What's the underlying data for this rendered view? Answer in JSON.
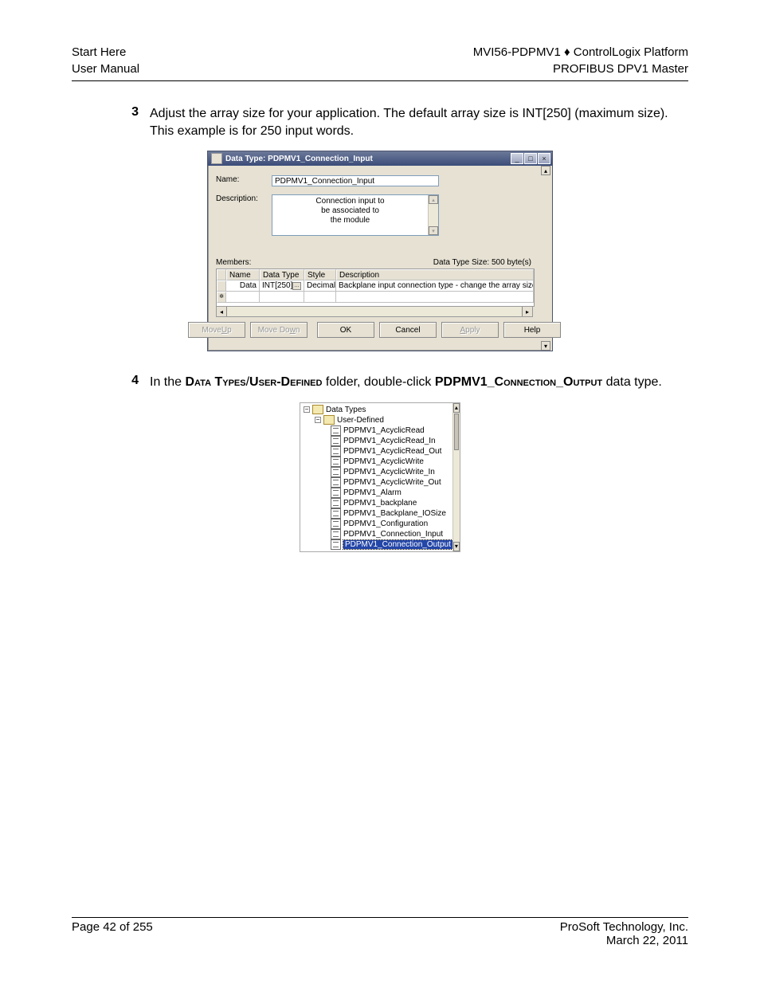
{
  "header": {
    "left1": "Start Here",
    "left2": "User Manual",
    "right1": "MVI56-PDPMV1 ♦ ControlLogix Platform",
    "right2": "PROFIBUS DPV1 Master"
  },
  "step3": {
    "num": "3",
    "text": "Adjust the array size for your application. The default array size is INT[250] (maximum size). This example is for 250 input words."
  },
  "dialog": {
    "title": "Data Type: PDPMV1_Connection_Input",
    "name_label": "Name:",
    "name_value": "PDPMV1_Connection_Input",
    "desc_label": "Description:",
    "desc_line1": "Connection input to",
    "desc_line2": "be associated to",
    "desc_line3": "the module",
    "members_label": "Members:",
    "size_label": "Data Type Size: 500 byte(s)",
    "col_name": "Name",
    "col_type": "Data Type",
    "col_style": "Style",
    "col_desc": "Description",
    "row_name": "Data",
    "row_type": "INT[250]",
    "row_style": "Decimal",
    "row_desc": "Backplane input connection type - change the array size for your applic",
    "btn_moveup_pre": "Move ",
    "btn_moveup_ul": "U",
    "btn_moveup_post": "p",
    "btn_movedown_pre": "Move Do",
    "btn_movedown_ul": "w",
    "btn_movedown_post": "n",
    "btn_ok": "OK",
    "btn_cancel": "Cancel",
    "btn_apply_pre": "",
    "btn_apply_ul": "A",
    "btn_apply_post": "pply",
    "btn_help": "Help"
  },
  "step4": {
    "num": "4",
    "prefix": "In the ",
    "dt": "Data Types",
    "slash": "/",
    "ud": "User-Defined",
    "mid": " folder, double-click ",
    "co": "PDPMV1_Connection_Output",
    "suffix": " data type."
  },
  "tree": {
    "root": "Data Types",
    "folder": "User-Defined",
    "items": [
      "PDPMV1_AcyclicRead",
      "PDPMV1_AcyclicRead_In",
      "PDPMV1_AcyclicRead_Out",
      "PDPMV1_AcyclicWrite",
      "PDPMV1_AcyclicWrite_In",
      "PDPMV1_AcyclicWrite_Out",
      "PDPMV1_Alarm",
      "PDPMV1_backplane",
      "PDPMV1_Backplane_IOSize",
      "PDPMV1_Configuration",
      "PDPMV1_Connection_Input",
      "PDPMV1_Connection_Output"
    ],
    "selected_index": 11
  },
  "footer": {
    "left": "Page 42 of 255",
    "right1": "ProSoft Technology, Inc.",
    "right2": "March 22, 2011"
  }
}
